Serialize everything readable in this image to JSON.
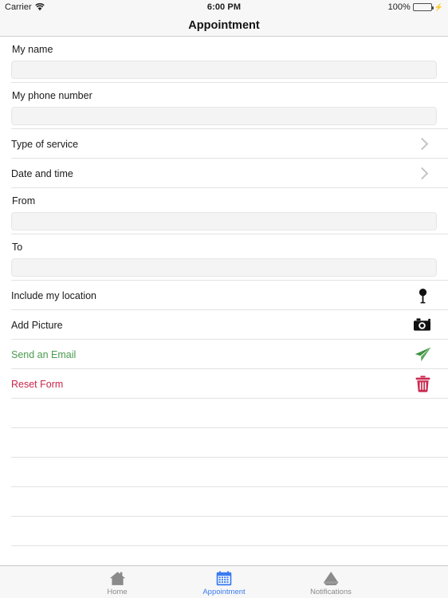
{
  "status_bar": {
    "carrier": "Carrier",
    "wifi_icon": "wifi-icon",
    "time": "6:00 PM",
    "battery_percent": "100%",
    "battery_icon": "battery-icon",
    "charging_icon": "lightning-bolt-icon",
    "battery_color": "#4cd25f"
  },
  "nav_bar": {
    "title": "Appointment"
  },
  "form": {
    "fields": [
      {
        "label": "My name",
        "value": "",
        "placeholder": ""
      },
      {
        "label": "My phone number",
        "value": "",
        "placeholder": ""
      }
    ],
    "disclosure_rows": [
      {
        "label": "Type of service",
        "icon": "chevron-right-icon"
      },
      {
        "label": "Date and time",
        "icon": "chevron-right-icon"
      }
    ],
    "range_fields": [
      {
        "label": "From",
        "value": "",
        "placeholder": ""
      },
      {
        "label": "To",
        "value": "",
        "placeholder": ""
      }
    ],
    "action_rows": [
      {
        "label": "Include my location",
        "icon": "location-pin-icon",
        "color": "#1a1a1a"
      },
      {
        "label": "Add Picture",
        "icon": "camera-icon",
        "color": "#1a1a1a"
      },
      {
        "label": "Send an Email",
        "icon": "send-paper-plane-icon",
        "color": "#4a9b4f"
      },
      {
        "label": "Reset Form",
        "icon": "trash-icon",
        "color": "#c9254b"
      }
    ],
    "empty_row_count": 6
  },
  "tab_bar": {
    "active_color": "#3a7bf0",
    "inactive_color": "#8a8a8a",
    "tabs": [
      {
        "label": "Home",
        "icon": "home-icon",
        "active": false
      },
      {
        "label": "Appointment",
        "icon": "calendar-icon",
        "active": true
      },
      {
        "label": "Notifications",
        "icon": "megaphone-icon",
        "active": false
      }
    ]
  }
}
